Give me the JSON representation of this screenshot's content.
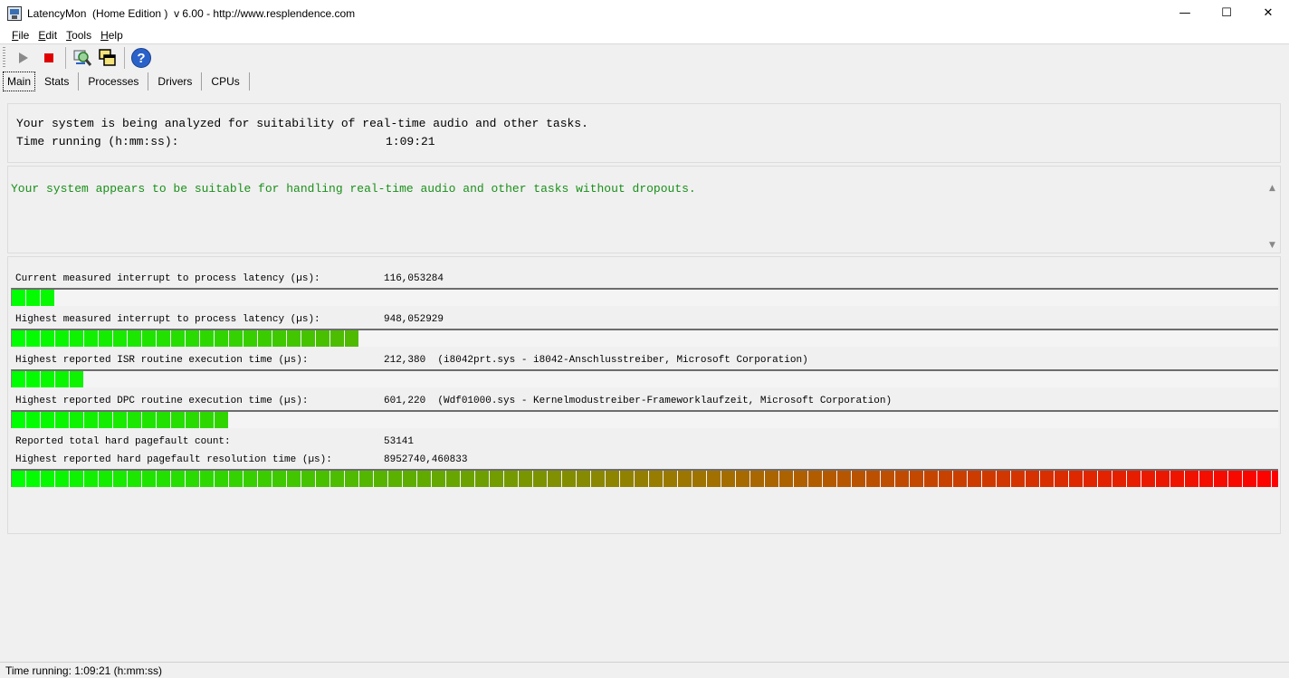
{
  "window": {
    "title": "LatencyMon  (Home Edition )  v 6.00 - http://www.resplendence.com",
    "controls": {
      "minimize": "—",
      "maximize": "☐",
      "close": "✕"
    }
  },
  "menu": {
    "items": [
      {
        "access": "F",
        "rest": "ile"
      },
      {
        "access": "E",
        "rest": "dit"
      },
      {
        "access": "T",
        "rest": "ools"
      },
      {
        "access": "H",
        "rest": "elp"
      }
    ]
  },
  "toolbar": {
    "icons": [
      "play-icon",
      "stop-icon",
      "search-report-icon",
      "windows-icon",
      "help-icon"
    ],
    "help_glyph": "?"
  },
  "tabs": [
    {
      "label": "Main",
      "active": true
    },
    {
      "label": "Stats",
      "active": false
    },
    {
      "label": "Processes",
      "active": false
    },
    {
      "label": "Drivers",
      "active": false
    },
    {
      "label": "CPUs",
      "active": false
    }
  ],
  "summary": {
    "analyzing": "Your system is being analyzed for suitability of real-time audio and other tasks.",
    "time_label": "Time running (h:mm:ss):",
    "time_value": "1:09:21"
  },
  "conclusion": {
    "text": "Your system appears to be suitable for handling real-time audio and other tasks without dropouts.",
    "scroll_up": "▲",
    "scroll_down": "▼"
  },
  "metrics": {
    "current_latency": {
      "label": "Current measured interrupt to process latency (µs):",
      "value": "116,053284",
      "bar_segments": 3
    },
    "highest_latency": {
      "label": "Highest measured interrupt to process latency (µs):",
      "value": "948,052929",
      "bar_segments": 24
    },
    "isr": {
      "label": "Highest reported ISR routine execution time (µs):",
      "value": "212,380  (i8042prt.sys - i8042-Anschlusstreiber, Microsoft Corporation)",
      "bar_segments": 5
    },
    "dpc": {
      "label": "Highest reported DPC routine execution time (µs):",
      "value": "601,220  (Wdf01000.sys - Kernelmodustreiber-Frameworklaufzeit, Microsoft Corporation)",
      "bar_segments": 15
    },
    "pagefault_count": {
      "label": "Reported total hard pagefault count:",
      "value": "53141"
    },
    "pagefault_time": {
      "label": "Highest reported hard pagefault resolution time (µs):",
      "value": "8952740,460833",
      "bar_segments": 88
    }
  },
  "bar_total_segments": 88,
  "statusbar": {
    "text": "Time running: 1:09:21  (h:mm:ss)"
  }
}
